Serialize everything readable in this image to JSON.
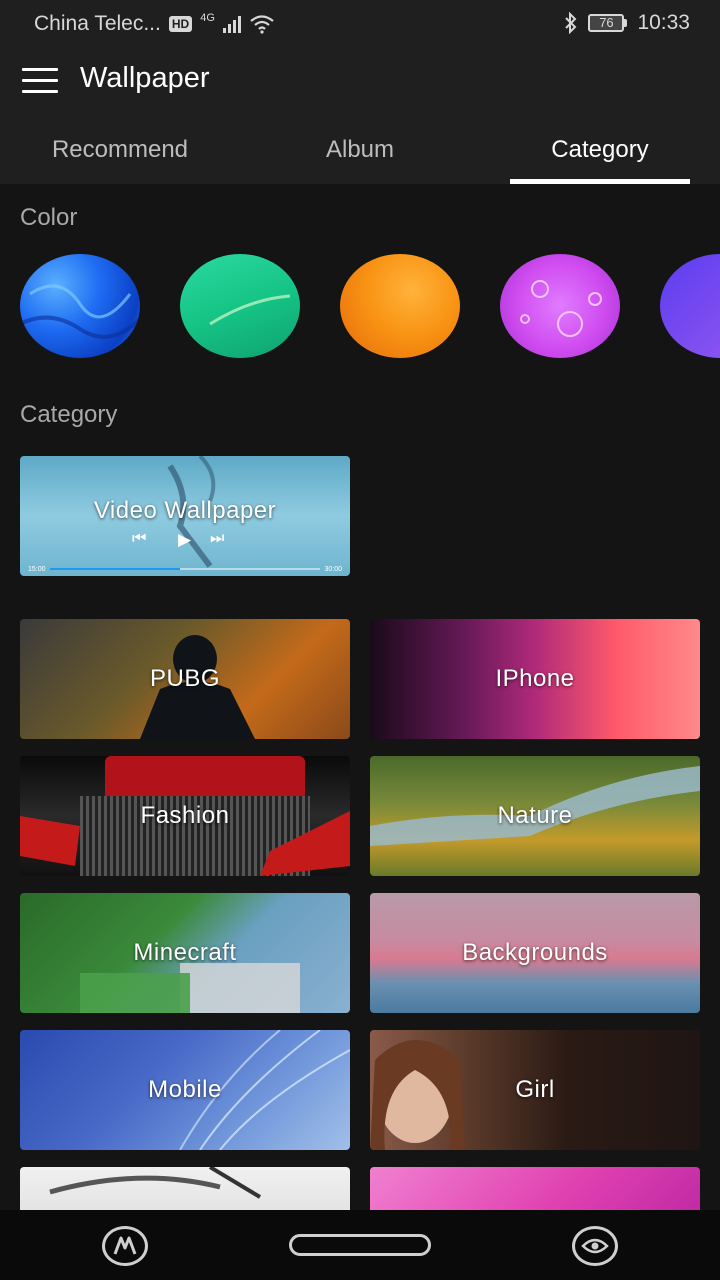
{
  "status_bar": {
    "carrier": "China Telec...",
    "network_badge": "HD",
    "network_type": "4G",
    "battery_level": "76",
    "time": "10:33"
  },
  "app_bar": {
    "title": "Wallpaper",
    "tabs": [
      {
        "label": "Recommend",
        "active": false
      },
      {
        "label": "Album",
        "active": false
      },
      {
        "label": "Category",
        "active": true
      }
    ]
  },
  "color_section": {
    "label": "Color",
    "swatches": [
      {
        "name": "blue",
        "color": "#1e6cf2"
      },
      {
        "name": "green",
        "color": "#16c486"
      },
      {
        "name": "orange",
        "color": "#f99414"
      },
      {
        "name": "magenta",
        "color": "#d04cf0"
      },
      {
        "name": "purple",
        "color": "#7a4cf0"
      }
    ]
  },
  "category_section": {
    "label": "Category",
    "video_tile": {
      "label": "Video Wallpaper",
      "time_start": "15:00",
      "time_end": "30:00",
      "progress": 0.48
    },
    "tiles": [
      {
        "label": "PUBG"
      },
      {
        "label": "IPhone"
      },
      {
        "label": "Fashion"
      },
      {
        "label": "Nature"
      },
      {
        "label": "Minecraft"
      },
      {
        "label": "Backgrounds"
      },
      {
        "label": "Mobile"
      },
      {
        "label": "Girl"
      },
      {
        "label": ""
      },
      {
        "label": ""
      }
    ]
  },
  "nav_bar": {
    "left_icon": "app-logo-icon",
    "right_icon": "eye-icon"
  }
}
